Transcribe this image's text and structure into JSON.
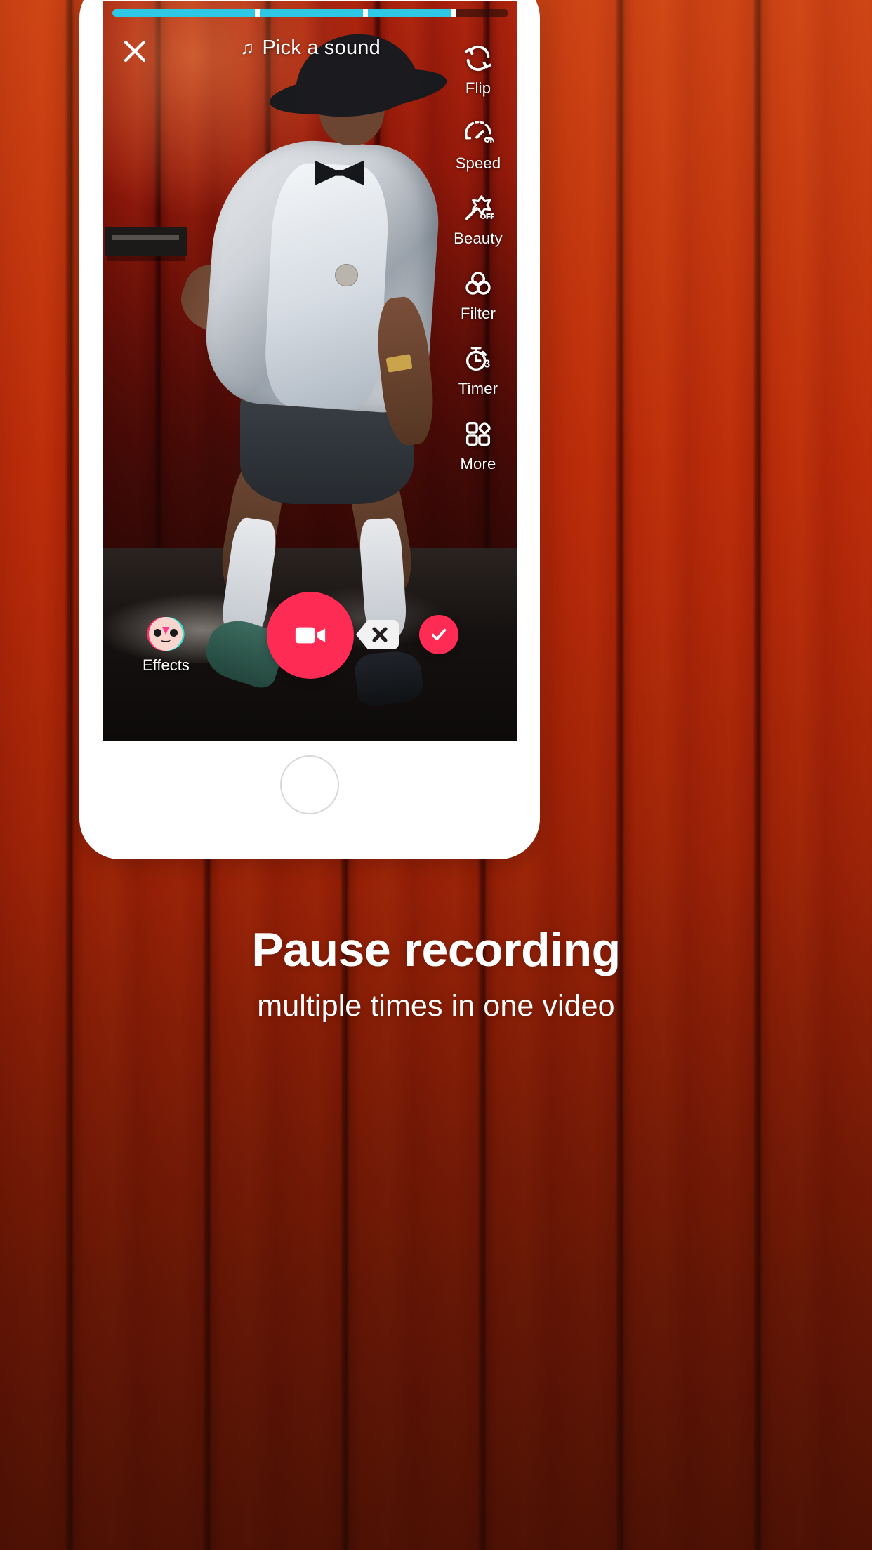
{
  "background": {
    "name": "orange-wood-panel",
    "color": "#d4622e"
  },
  "phone": {
    "home_button": "home-button"
  },
  "camera": {
    "progress": {
      "name": "recording-progress-bar",
      "fill_color": "#2ec8e6",
      "track_color": "rgba(40,18,12,0.35)",
      "segments_percent": [
        36,
        26,
        21
      ],
      "total_filled_percent": 83
    },
    "top_bar": {
      "close_label": "Close",
      "close_icon": "close-icon",
      "pick_sound_label": "Pick a sound",
      "music_note_icon": "music-note-icon",
      "music_note_glyph": "♫"
    },
    "sidebar": [
      {
        "icon": "flip-camera-icon",
        "label": "Flip",
        "state": ""
      },
      {
        "icon": "speed-icon",
        "label": "Speed",
        "state": "ON"
      },
      {
        "icon": "beauty-wand-icon",
        "label": "Beauty",
        "state": "OFF"
      },
      {
        "icon": "filter-icon",
        "label": "Filter",
        "state": ""
      },
      {
        "icon": "timer-icon",
        "label": "Timer",
        "state": "3"
      },
      {
        "icon": "more-grid-icon",
        "label": "More",
        "state": ""
      }
    ],
    "controls": {
      "effects_label": "Effects",
      "effects_icon": "effects-face-icon",
      "record_icon": "video-camera-icon",
      "record_color": "#fe2c55",
      "delete_icon": "backspace-delete-icon",
      "confirm_icon": "checkmark-icon",
      "confirm_color": "#fe2c55"
    }
  },
  "caption": {
    "title": "Pause recording",
    "subtitle": "multiple times in one video"
  }
}
